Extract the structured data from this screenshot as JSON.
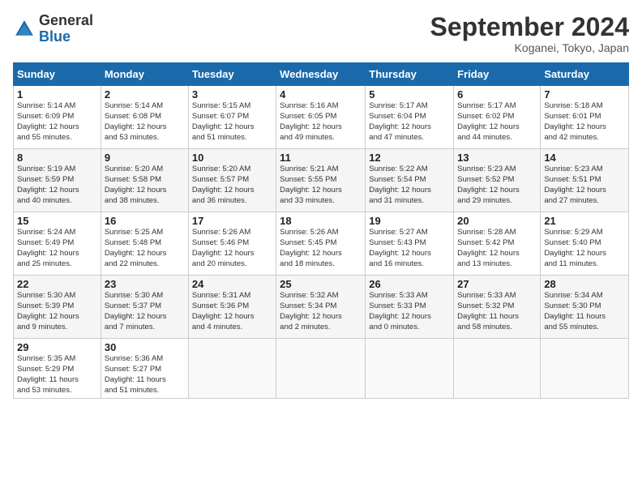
{
  "header": {
    "logo_general": "General",
    "logo_blue": "Blue",
    "month_title": "September 2024",
    "subtitle": "Koganei, Tokyo, Japan"
  },
  "weekdays": [
    "Sunday",
    "Monday",
    "Tuesday",
    "Wednesday",
    "Thursday",
    "Friday",
    "Saturday"
  ],
  "weeks": [
    [
      {
        "day": "1",
        "info": "Sunrise: 5:14 AM\nSunset: 6:09 PM\nDaylight: 12 hours\nand 55 minutes."
      },
      {
        "day": "2",
        "info": "Sunrise: 5:14 AM\nSunset: 6:08 PM\nDaylight: 12 hours\nand 53 minutes."
      },
      {
        "day": "3",
        "info": "Sunrise: 5:15 AM\nSunset: 6:07 PM\nDaylight: 12 hours\nand 51 minutes."
      },
      {
        "day": "4",
        "info": "Sunrise: 5:16 AM\nSunset: 6:05 PM\nDaylight: 12 hours\nand 49 minutes."
      },
      {
        "day": "5",
        "info": "Sunrise: 5:17 AM\nSunset: 6:04 PM\nDaylight: 12 hours\nand 47 minutes."
      },
      {
        "day": "6",
        "info": "Sunrise: 5:17 AM\nSunset: 6:02 PM\nDaylight: 12 hours\nand 44 minutes."
      },
      {
        "day": "7",
        "info": "Sunrise: 5:18 AM\nSunset: 6:01 PM\nDaylight: 12 hours\nand 42 minutes."
      }
    ],
    [
      {
        "day": "8",
        "info": "Sunrise: 5:19 AM\nSunset: 5:59 PM\nDaylight: 12 hours\nand 40 minutes."
      },
      {
        "day": "9",
        "info": "Sunrise: 5:20 AM\nSunset: 5:58 PM\nDaylight: 12 hours\nand 38 minutes."
      },
      {
        "day": "10",
        "info": "Sunrise: 5:20 AM\nSunset: 5:57 PM\nDaylight: 12 hours\nand 36 minutes."
      },
      {
        "day": "11",
        "info": "Sunrise: 5:21 AM\nSunset: 5:55 PM\nDaylight: 12 hours\nand 33 minutes."
      },
      {
        "day": "12",
        "info": "Sunrise: 5:22 AM\nSunset: 5:54 PM\nDaylight: 12 hours\nand 31 minutes."
      },
      {
        "day": "13",
        "info": "Sunrise: 5:23 AM\nSunset: 5:52 PM\nDaylight: 12 hours\nand 29 minutes."
      },
      {
        "day": "14",
        "info": "Sunrise: 5:23 AM\nSunset: 5:51 PM\nDaylight: 12 hours\nand 27 minutes."
      }
    ],
    [
      {
        "day": "15",
        "info": "Sunrise: 5:24 AM\nSunset: 5:49 PM\nDaylight: 12 hours\nand 25 minutes."
      },
      {
        "day": "16",
        "info": "Sunrise: 5:25 AM\nSunset: 5:48 PM\nDaylight: 12 hours\nand 22 minutes."
      },
      {
        "day": "17",
        "info": "Sunrise: 5:26 AM\nSunset: 5:46 PM\nDaylight: 12 hours\nand 20 minutes."
      },
      {
        "day": "18",
        "info": "Sunrise: 5:26 AM\nSunset: 5:45 PM\nDaylight: 12 hours\nand 18 minutes."
      },
      {
        "day": "19",
        "info": "Sunrise: 5:27 AM\nSunset: 5:43 PM\nDaylight: 12 hours\nand 16 minutes."
      },
      {
        "day": "20",
        "info": "Sunrise: 5:28 AM\nSunset: 5:42 PM\nDaylight: 12 hours\nand 13 minutes."
      },
      {
        "day": "21",
        "info": "Sunrise: 5:29 AM\nSunset: 5:40 PM\nDaylight: 12 hours\nand 11 minutes."
      }
    ],
    [
      {
        "day": "22",
        "info": "Sunrise: 5:30 AM\nSunset: 5:39 PM\nDaylight: 12 hours\nand 9 minutes."
      },
      {
        "day": "23",
        "info": "Sunrise: 5:30 AM\nSunset: 5:37 PM\nDaylight: 12 hours\nand 7 minutes."
      },
      {
        "day": "24",
        "info": "Sunrise: 5:31 AM\nSunset: 5:36 PM\nDaylight: 12 hours\nand 4 minutes."
      },
      {
        "day": "25",
        "info": "Sunrise: 5:32 AM\nSunset: 5:34 PM\nDaylight: 12 hours\nand 2 minutes."
      },
      {
        "day": "26",
        "info": "Sunrise: 5:33 AM\nSunset: 5:33 PM\nDaylight: 12 hours\nand 0 minutes."
      },
      {
        "day": "27",
        "info": "Sunrise: 5:33 AM\nSunset: 5:32 PM\nDaylight: 11 hours\nand 58 minutes."
      },
      {
        "day": "28",
        "info": "Sunrise: 5:34 AM\nSunset: 5:30 PM\nDaylight: 11 hours\nand 55 minutes."
      }
    ],
    [
      {
        "day": "29",
        "info": "Sunrise: 5:35 AM\nSunset: 5:29 PM\nDaylight: 11 hours\nand 53 minutes."
      },
      {
        "day": "30",
        "info": "Sunrise: 5:36 AM\nSunset: 5:27 PM\nDaylight: 11 hours\nand 51 minutes."
      },
      {
        "day": "",
        "info": ""
      },
      {
        "day": "",
        "info": ""
      },
      {
        "day": "",
        "info": ""
      },
      {
        "day": "",
        "info": ""
      },
      {
        "day": "",
        "info": ""
      }
    ]
  ]
}
